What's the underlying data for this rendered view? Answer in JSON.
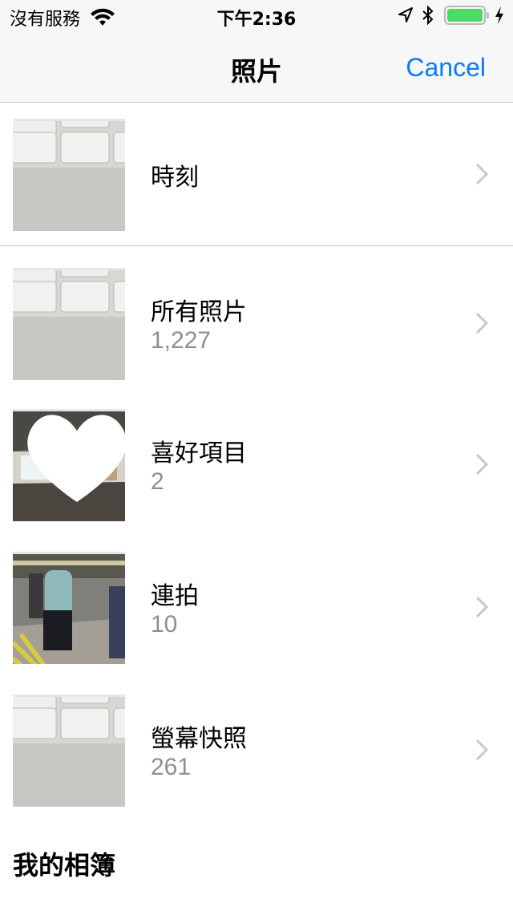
{
  "status_bar": {
    "carrier": "沒有服務",
    "time": "下午2:36",
    "battery_color": "#4cd964"
  },
  "nav": {
    "title": "照片",
    "cancel_label": "Cancel",
    "accent_color": "#0a7aff"
  },
  "moments": {
    "title": "時刻"
  },
  "albums": [
    {
      "title": "所有照片",
      "count": "1,227",
      "thumb": "keyboard"
    },
    {
      "title": "喜好項目",
      "count": "2",
      "thumb": "station",
      "icon": "heart-icon"
    },
    {
      "title": "連拍",
      "count": "10",
      "thumb": "crowd"
    },
    {
      "title": "螢幕快照",
      "count": "261",
      "thumb": "keyboard"
    }
  ],
  "section": {
    "title": "我的相簿"
  }
}
